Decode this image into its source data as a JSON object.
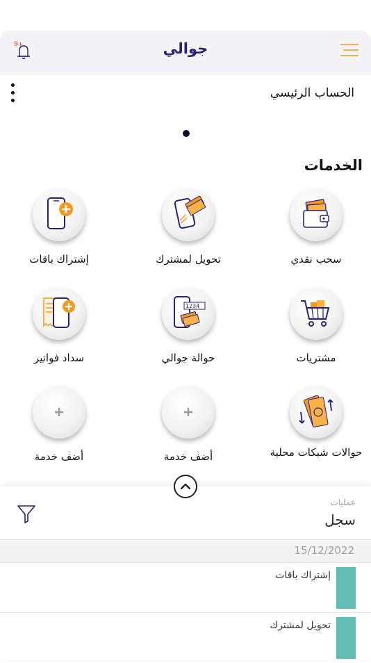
{
  "header": {
    "title": "جوالي",
    "notification_badge": "9+",
    "menu_icon": "hamburger-menu-icon",
    "bell_icon": "bell-icon"
  },
  "account": {
    "title": "الحساب الرئيسي",
    "more_icon": "kebab-menu-icon"
  },
  "services": {
    "title": "الخدمات",
    "items": [
      {
        "label": "سحب نقدي",
        "icon": "cash-wallet-icon"
      },
      {
        "label": "تحويل لمشترك",
        "icon": "phone-money-transfer-icon"
      },
      {
        "label": "إشتراك باقات",
        "icon": "phone-add-package-icon"
      },
      {
        "label": "مشتريات",
        "icon": "shopping-cart-icon"
      },
      {
        "label": "حوالة جوالي",
        "icon": "phone-remittance-icon"
      },
      {
        "label": "سداد فواتير",
        "icon": "bill-payment-icon"
      },
      {
        "label": "حوالات شبكات محلية",
        "icon": "local-networks-transfer-icon"
      },
      {
        "label": "أضف خدمة",
        "icon": "plus-icon"
      },
      {
        "label": "أضف خدمة",
        "icon": "plus-icon"
      }
    ]
  },
  "transactions": {
    "caption": "عمليات",
    "title": "سجل",
    "filter_icon": "filter-icon",
    "date": "15/12/2022",
    "items": [
      {
        "label": "إشتراك باقات"
      },
      {
        "label": "تحويل لمشترك"
      }
    ]
  },
  "colors": {
    "brand_purple": "#2b1f7a",
    "accent_orange": "#f39a1e",
    "badge_red": "#e53935",
    "teal": "#5fbdb3"
  }
}
